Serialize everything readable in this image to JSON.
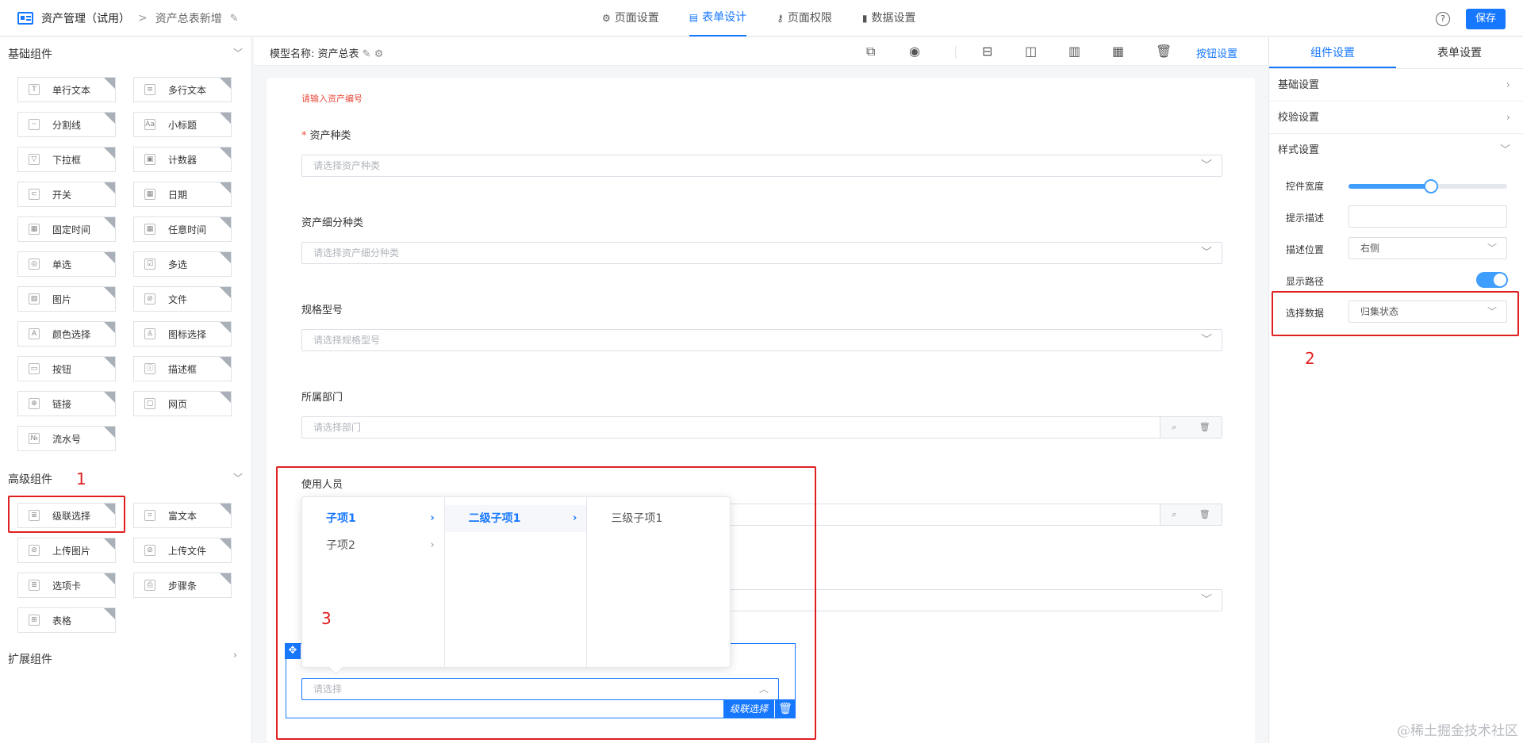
{
  "header": {
    "app_title": "资产管理（试用）",
    "breadcrumb_sep": ">",
    "breadcrumb": "资产总表新增",
    "tabs": [
      {
        "label": "页面设置",
        "icon": "gear-icon"
      },
      {
        "label": "表单设计",
        "icon": "document-icon"
      },
      {
        "label": "页面权限",
        "icon": "key-icon"
      },
      {
        "label": "数据设置",
        "icon": "bar-chart-icon"
      }
    ],
    "active_tab": "表单设计",
    "help": "?",
    "save_label": "保存"
  },
  "left": {
    "basic_title": "基础组件",
    "basic": [
      "单行文本",
      "多行文本",
      "分割线",
      "小标题",
      "下拉框",
      "计数器",
      "开关",
      "日期",
      "固定时间",
      "任意时间",
      "单选",
      "多选",
      "图片",
      "文件",
      "颜色选择",
      "图标选择",
      "按钮",
      "描述框",
      "链接",
      "网页",
      "流水号"
    ],
    "advanced_title": "高级组件",
    "advanced": [
      "级联选择",
      "富文本",
      "上传图片",
      "上传文件",
      "选项卡",
      "步骤条",
      "表格"
    ],
    "ext_title": "扩展组件",
    "annotation": "1"
  },
  "canvas": {
    "model_label": "模型名称: 资产总表",
    "button_settings": "按钮设置",
    "error_text": "请输入资产编号",
    "fields": [
      {
        "label": "资产种类",
        "required": "*",
        "placeholder": "请选择资产种类"
      },
      {
        "label": "资产细分种类",
        "placeholder": "请选择资产细分种类"
      },
      {
        "label": "规格型号",
        "placeholder": "请选择规格型号"
      },
      {
        "label": "所属部门",
        "placeholder": "请选择部门"
      },
      {
        "label": "使用人员",
        "placeholder": ""
      }
    ],
    "cascade_placeholder": "请选择",
    "cascade_tag": "级联选择",
    "annotation": "3",
    "popper": {
      "col1": [
        "子项1",
        "子项2"
      ],
      "col2": [
        "二级子项1"
      ],
      "col3": [
        "三级子项1"
      ]
    }
  },
  "right": {
    "tabs": [
      "组件设置",
      "表单设置"
    ],
    "sections": [
      "基础设置",
      "校验设置",
      "样式设置"
    ],
    "props": {
      "width_label": "控件宽度",
      "width_value": 0.52,
      "hint_label": "提示描述",
      "hint_value": "",
      "desc_pos_label": "描述位置",
      "desc_pos_value": "右侧",
      "show_path_label": "显示路径",
      "show_path_on": true,
      "data_label": "选择数据",
      "data_value": "归集状态"
    },
    "annotation": "2"
  },
  "watermark": "@稀土掘金技术社区",
  "colors": {
    "accent": "#1677ff",
    "annotation": "#e02020",
    "error": "#e74c3c"
  }
}
